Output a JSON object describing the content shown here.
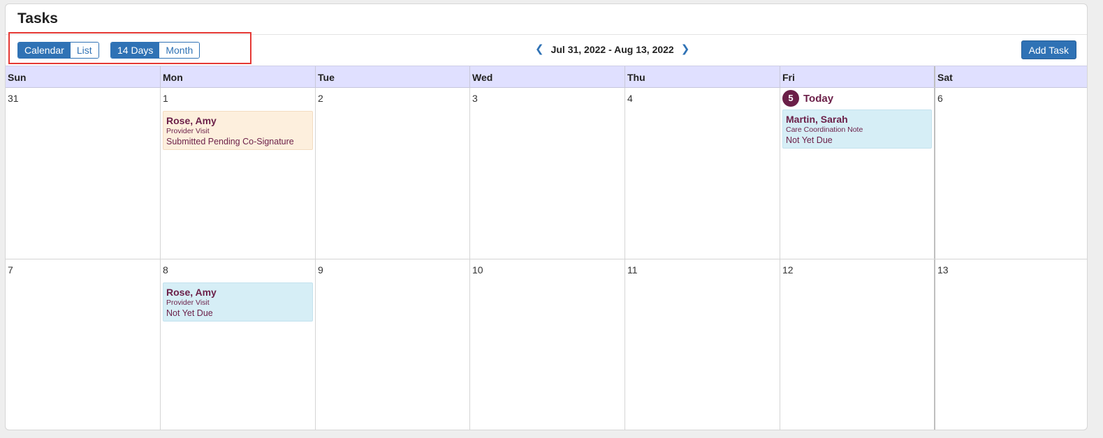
{
  "page": {
    "title": "Tasks"
  },
  "toolbar": {
    "view_options": [
      "Calendar",
      "List"
    ],
    "active_view": "Calendar",
    "range_options": [
      "14 Days",
      "Month"
    ],
    "active_range": "14 Days",
    "date_range": "Jul 31, 2022 - Aug 13, 2022",
    "prev_icon": "chevron-left-icon",
    "next_icon": "chevron-right-icon",
    "add_task_label": "Add Task"
  },
  "calendar": {
    "weekdays": [
      "Sun",
      "Mon",
      "Tue",
      "Wed",
      "Thu",
      "Fri",
      "Sat"
    ],
    "today_label": "Today",
    "weeks": [
      [
        "31",
        "1",
        "2",
        "3",
        "4",
        "5",
        "6"
      ],
      [
        "7",
        "8",
        "9",
        "10",
        "11",
        "12",
        "13"
      ]
    ],
    "tasks": {
      "w1_mon": {
        "name": "Rose, Amy",
        "type": "Provider Visit",
        "status": "Submitted Pending Co-Signature"
      },
      "w1_fri": {
        "name": "Martin, Sarah",
        "type": "Care Coordination Note",
        "status": "Not Yet Due"
      },
      "w2_mon": {
        "name": "Rose, Amy",
        "type": "Provider Visit",
        "status": "Not Yet Due"
      }
    }
  },
  "colors": {
    "accent": "#2f72b5",
    "header_bg": "#e0e0ff",
    "today": "#6b1f48",
    "task_pending_bg": "#fdefdd",
    "task_due_bg": "#d6eef6",
    "highlight_box": "#e53935"
  }
}
